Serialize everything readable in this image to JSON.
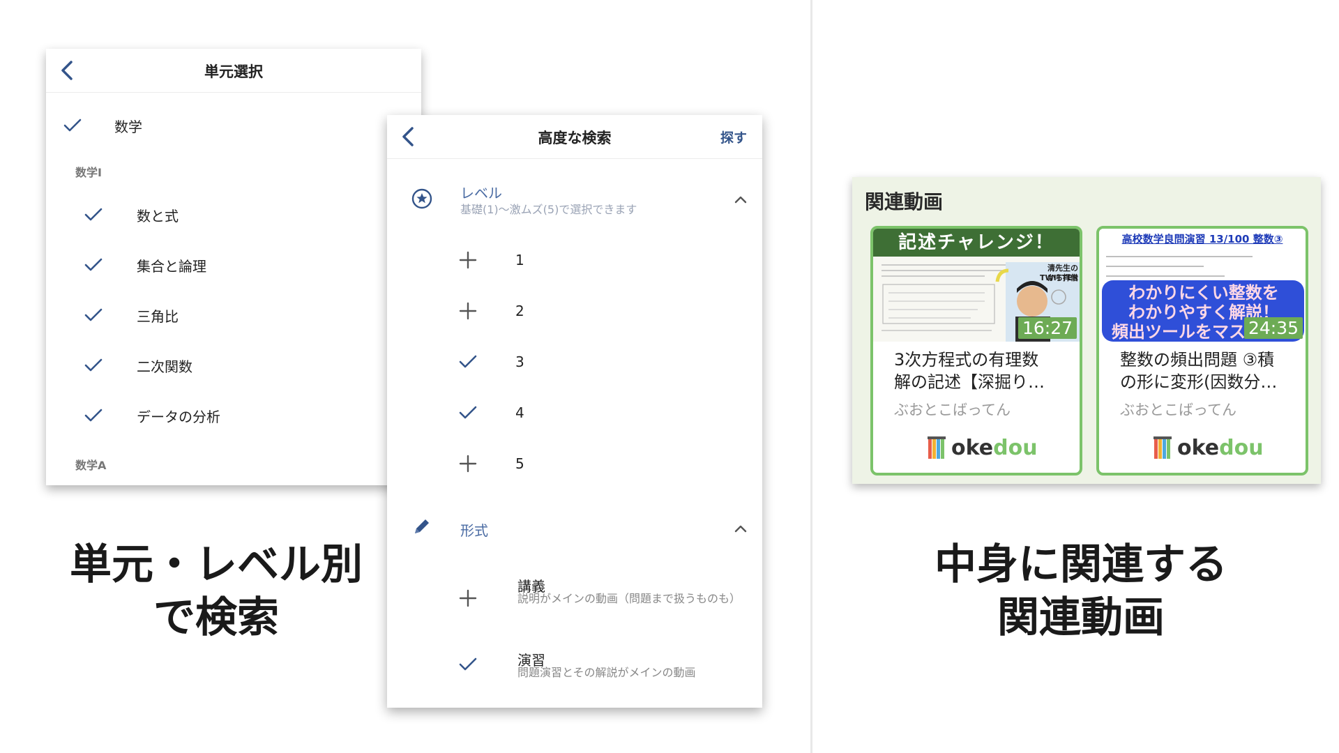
{
  "unit_panel": {
    "title": "単元選択",
    "items": [
      {
        "type": "item",
        "label": "数学",
        "checked": true,
        "level": 0
      },
      {
        "type": "section",
        "label": "数学Ⅰ"
      },
      {
        "type": "item",
        "label": "数と式",
        "checked": true,
        "level": 1
      },
      {
        "type": "item",
        "label": "集合と論理",
        "checked": true,
        "level": 1
      },
      {
        "type": "item",
        "label": "三角比",
        "checked": true,
        "level": 1
      },
      {
        "type": "item",
        "label": "二次関数",
        "checked": true,
        "level": 1
      },
      {
        "type": "item",
        "label": "データの分析",
        "checked": true,
        "level": 1
      },
      {
        "type": "section",
        "label": "数学A"
      }
    ]
  },
  "search_panel": {
    "title": "高度な検索",
    "action": "探す",
    "level_section": {
      "title": "レベル",
      "subtitle": "基礎(1)〜激ムズ(5)で選択できます",
      "options": [
        {
          "label": "1",
          "selected": false
        },
        {
          "label": "2",
          "selected": false
        },
        {
          "label": "3",
          "selected": true
        },
        {
          "label": "4",
          "selected": true
        },
        {
          "label": "5",
          "selected": false
        }
      ]
    },
    "format_section": {
      "title": "形式",
      "options": [
        {
          "title": "講義",
          "desc": "説明がメインの動画（問題まで扱うものも）",
          "selected": false
        },
        {
          "title": "演習",
          "desc": "問題演習とその解説がメインの動画",
          "selected": true
        }
      ]
    }
  },
  "captions": {
    "left_line1": "単元・レベル別",
    "left_line2": "で検索",
    "right_line1": "中身に関連する",
    "right_line2": "関連動画"
  },
  "related": {
    "title": "関連動画",
    "videos": [
      {
        "thumb_banner": "記述チャレンジ！",
        "thumb_badge_line1": "清先生のTWITTER",
        "thumb_badge_line2": "から拝借",
        "duration": "16:27",
        "title_line1": "3次方程式の有理数",
        "title_line2": "解の記述【深掘り…",
        "channel": "ぶおとこばってん",
        "logo_a": "oke",
        "logo_b": "dou"
      },
      {
        "thumb_banner": "高校数学良問演習 13/100 整数③",
        "thumb_bubble_line1": "わかりにくい整数を",
        "thumb_bubble_line2": "わかりやすく解説！",
        "thumb_bubble_line3": "頻出ツールをマス",
        "duration": "24:35",
        "title_line1": "整数の頻出問題 ③積",
        "title_line2": "の形に変形(因数分…",
        "channel": "ぶおとこばってん",
        "logo_a": "oke",
        "logo_b": "dou"
      }
    ]
  },
  "colors": {
    "accent_blue": "#4a6ba3",
    "card_green": "#7cc36a",
    "panel_bg": "#eef3e6"
  }
}
